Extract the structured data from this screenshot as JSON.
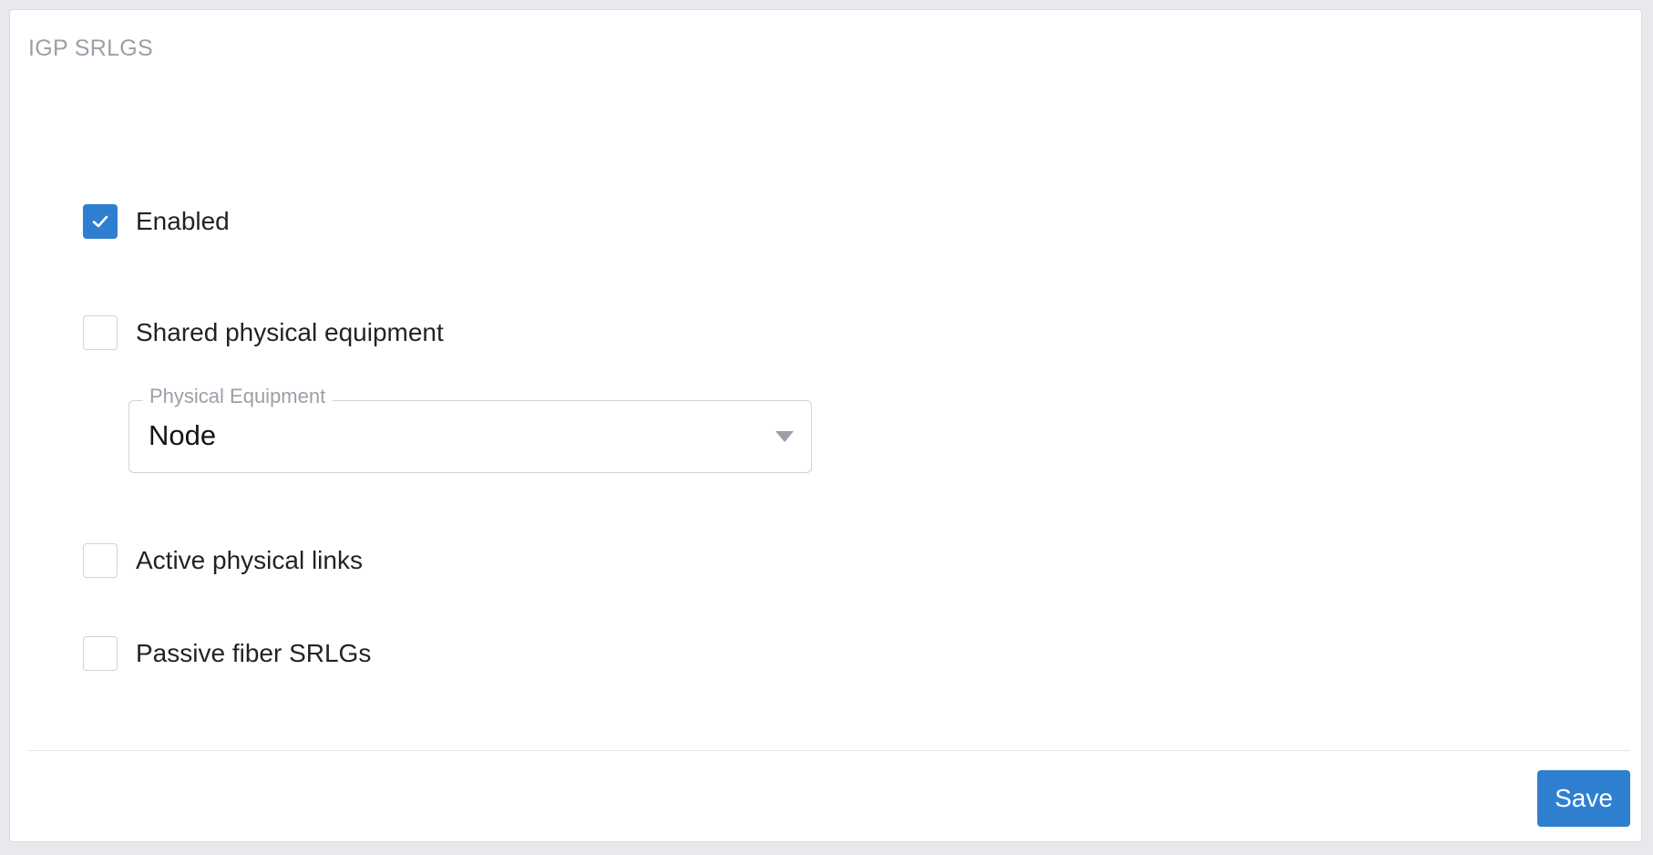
{
  "panel": {
    "title": "IGP SRLGS"
  },
  "options": {
    "enabled": {
      "label": "Enabled",
      "checked": true
    },
    "shared_physical_equipment": {
      "label": "Shared physical equipment",
      "checked": false
    },
    "active_physical_links": {
      "label": "Active physical links",
      "checked": false
    },
    "passive_fiber_srlgs": {
      "label": "Passive fiber SRLGs",
      "checked": false
    }
  },
  "physical_equipment": {
    "label": "Physical Equipment",
    "value": "Node"
  },
  "footer": {
    "save_label": "Save"
  },
  "colors": {
    "accent": "#2f7fd1",
    "muted_text": "#9aa0a8",
    "border": "#cfd3d8"
  },
  "icons": {
    "check": "checkmark-icon",
    "dropdown": "caret-down-icon"
  }
}
